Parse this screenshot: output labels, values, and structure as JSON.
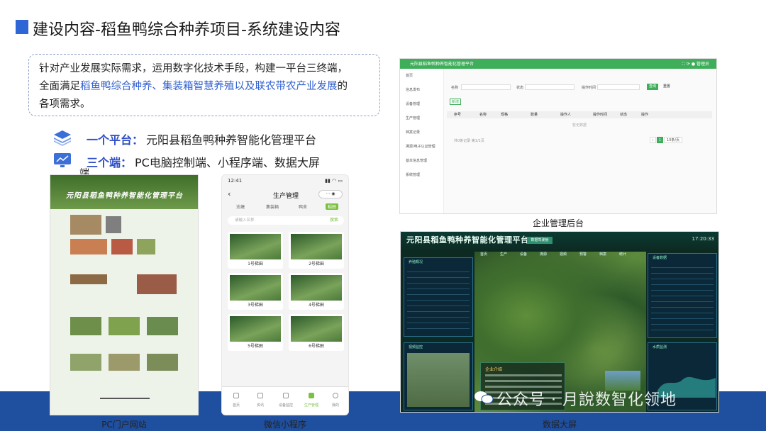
{
  "title": "建设内容-稻鱼鸭综合种养项目-系统建设内容",
  "desc": {
    "line1": "针对产业发展实际需求，运用数字化技术手段，构建一平台三终端，",
    "line2_a": "全面满足",
    "line2_hl": "稻鱼鸭综合种养、集装箱智慧养殖以及联农带农产业发展",
    "line2_b": "的",
    "line3": "各项需求。"
  },
  "items": [
    {
      "label": "一个平台：",
      "text": "元阳县稻鱼鸭种养智能化管理平台",
      "icon": "layers-icon"
    },
    {
      "label": "三个端：",
      "text": "PC电脑控制端、小程序端、数据大屏",
      "tail": "端",
      "icon": "monitor-icon"
    }
  ],
  "shots": {
    "pc": {
      "caption": "PC门户网站",
      "hero_title": "元阳县稻鱼鸭种养智能化管理平台"
    },
    "mini": {
      "caption": "微信小程序",
      "time": "12:41",
      "nav_title": "生产管理",
      "tabs": [
        "池塘",
        "集装箱",
        "鸭舍",
        "稻田"
      ],
      "search_placeholder": "请输入名称",
      "search_btn": "搜索",
      "cards": [
        "1号梯田",
        "2号梯田",
        "3号梯田",
        "4号梯田",
        "5号梯田",
        "6号梯田"
      ],
      "tabbar": [
        "首页",
        "资讯",
        "设备监控",
        "生产管理",
        "我的"
      ]
    },
    "admin": {
      "caption": "企业管理后台",
      "bar_title": "元阳县稻鱼鸭种养智能化管理平台",
      "bar_user": "管理员",
      "home": "首页",
      "side_items": [
        "信息发布",
        "设备管理",
        "生产管理",
        "档案记录",
        "溯源/电子认证管理",
        "基本信息管理",
        "系统管理"
      ],
      "filters": [
        "名称",
        "状态",
        "操作时间"
      ],
      "btn_search": "查询",
      "btn_reset": "重置",
      "btn_add": "新增",
      "columns": [
        "序号",
        "名称",
        "规格",
        "数量",
        "操作人",
        "操作时间",
        "状态",
        "操作"
      ],
      "empty": "暂无数据",
      "footer": "共0条记录 第1/1页",
      "page": "1",
      "per_page": "10条/页"
    },
    "big": {
      "caption": "数据大屏",
      "title": "元阳县稻鱼鸭种养智能化管理平台",
      "chip": "数据驾驶舱",
      "time": "17:20:33",
      "left_panel": "养殖概况",
      "right_panel": "设备数据",
      "left_bottom": "视频监控",
      "card_title": "企业介绍",
      "right_bottom": "水质监测",
      "nav": [
        "首页",
        "生产",
        "设备",
        "溯源",
        "视频",
        "预警",
        "档案",
        "统计"
      ]
    }
  },
  "watermark": "公众号 · 月說数智化领地",
  "colors": {
    "accent": "#2f66d6",
    "highlight": "#2f5fd0",
    "band": "#1f4f9f",
    "green": "#3fae5b"
  }
}
